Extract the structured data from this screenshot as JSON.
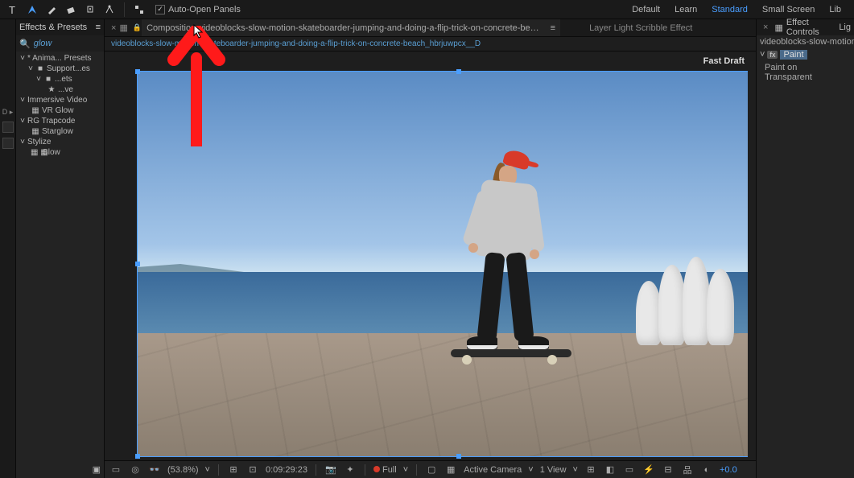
{
  "toolbar": {
    "auto_open_panels": "Auto-Open Panels"
  },
  "workspaces": {
    "default": "Default",
    "learn": "Learn",
    "standard": "Standard",
    "small_screen": "Small Screen",
    "lib": "Lib"
  },
  "effects_panel": {
    "title": "Effects & Presets",
    "search_value": "glow",
    "tree": [
      {
        "toggle": "˅",
        "label": "* Anima... Presets",
        "depth": 0,
        "icon": ""
      },
      {
        "toggle": "˅",
        "label": "Support...es",
        "depth": 1,
        "icon": "■"
      },
      {
        "toggle": "˅",
        "label": "...ets",
        "depth": 2,
        "icon": "■"
      },
      {
        "toggle": "",
        "label": "...ve",
        "depth": 3,
        "icon": "★"
      },
      {
        "toggle": "˅",
        "label": "Immersive Video",
        "depth": 0,
        "icon": ""
      },
      {
        "toggle": "",
        "label": "VR Glow",
        "depth": 1,
        "icon": "▦"
      },
      {
        "toggle": "˅",
        "label": "RG Trapcode",
        "depth": 0,
        "icon": ""
      },
      {
        "toggle": "",
        "label": "Starglow",
        "depth": 1,
        "icon": "▦"
      },
      {
        "toggle": "˅",
        "label": "Stylize",
        "depth": 0,
        "icon": ""
      },
      {
        "toggle": "",
        "label": "Glow",
        "depth": 1,
        "icon": "▦ ▦"
      }
    ]
  },
  "composition": {
    "tab_prefix": "Composition",
    "tab_name": "videoblocks-slow-motion-skateboarder-jumping-and-doing-a-flip-trick-on-concrete-beach_hbrjuwpcx__D",
    "layer_tab": "Layer Light Scribble Effect",
    "breadcrumb": "videoblocks-slow-motion-skateboarder-jumping-and-doing-a-flip-trick-on-concrete-beach_hbrjuwpcx__D",
    "fast_draft": "Fast Draft"
  },
  "footer": {
    "magnification": "(53.8%)",
    "timecode": "0:09:29:23",
    "resolution": "Full",
    "camera": "Active Camera",
    "view_count": "1 View",
    "exposure": "+0.0"
  },
  "effect_controls": {
    "title": "Effect Controls",
    "title_tab_suffix": "Lig",
    "layer_name": "videoblocks-slow-motion-skat",
    "fx_badge": "fx",
    "effect_name": "Paint",
    "prop1": "Paint on Transparent"
  }
}
